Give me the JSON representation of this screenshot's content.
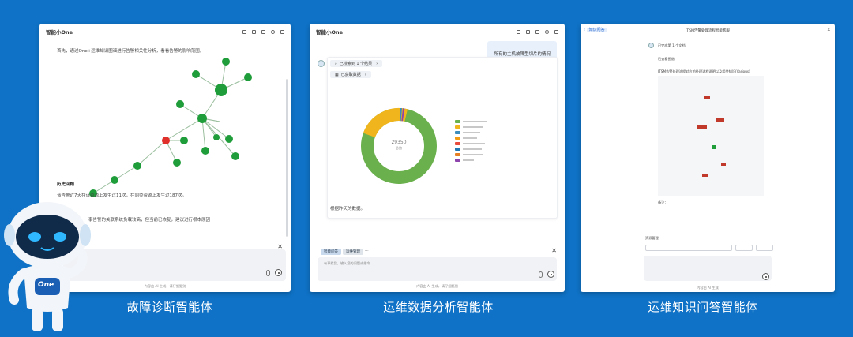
{
  "colors": {
    "background": "#0f72c6",
    "panel": "#ffffff",
    "node_green": "#1f9d3a",
    "node_red": "#e0302b",
    "donut_green": "#6ab04c",
    "donut_yellow": "#f0b51c",
    "donut_other": [
      "#3c8dbc",
      "#e74c3c",
      "#8e44ad",
      "#1abc9c",
      "#f39c12",
      "#2c3e50"
    ]
  },
  "panel1": {
    "title": "智能小One",
    "intro_text": "首先，通过One+运维知识图谱进行告警相关性分析，看看告警的影响范围。",
    "history_heading": "历史回顾",
    "history_line1": "该告警近7天在该资源上发生过11次，在同类资源上发生过187次。",
    "history_line2": "事告警的关联系统负载较高，但当前已恢复，建议进行根本原因",
    "footer_hint": "内容由 AI 生成，请仔细甄别",
    "caption": "故障诊断智能体"
  },
  "panel2": {
    "title": "智能小One",
    "user_message": "所有的主机故障型切片的情况",
    "step1": "已搜索到 1 个结果",
    "step2": "已获取数据",
    "donut_total": "29350",
    "donut_total_label": "总数",
    "answer_text": "根据昨天的数据。",
    "tab1": "智能问答",
    "tab2": "运维管理",
    "input_placeholder": "有事找我，输入您的问题或指令...",
    "footer_hint": "内容由 AI 生成，请仔细甄别",
    "caption": "运维数据分析智能体"
  },
  "panel3": {
    "tag": "知识问答",
    "doc_title": "ITSM告警处理流程智能客服",
    "step1": "已完成第 1 个文档",
    "step2": "已查看图谱",
    "answer_line": "ITSM告警处理流程对应的处理流程说明以及相关知识(Various)",
    "notes_label": "备注：",
    "form_label": "资源管理",
    "footer_hint": "内容由 AI 生成",
    "caption": "运维知识问答智能体"
  },
  "mascot": {
    "badge": "One"
  }
}
